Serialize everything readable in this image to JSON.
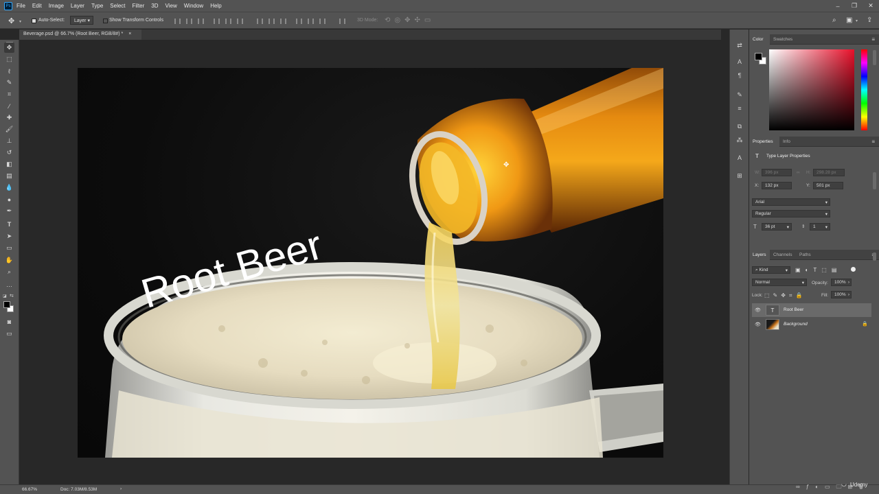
{
  "app": {
    "logo_text": "Ps",
    "menu": [
      "File",
      "Edit",
      "Image",
      "Layer",
      "Type",
      "Select",
      "Filter",
      "3D",
      "View",
      "Window",
      "Help"
    ]
  },
  "options_bar": {
    "auto_select_label": "Auto-Select:",
    "auto_select_value": "Layer",
    "show_transform_label": "Show Transform Controls",
    "mode_3d_label": "3D Mode:"
  },
  "document": {
    "tab_title": "Beverage.psd @ 66.7% (Root Beer, RGB/8#) *",
    "tab_close": "×",
    "canvas_text": "Root Beer"
  },
  "status": {
    "zoom": "66.67%",
    "doc_size": "Doc: 7.03M/8.53M",
    "arrow": "›"
  },
  "color_panel": {
    "tabs": [
      "Color",
      "Swatches"
    ],
    "fg_color": "#000000",
    "bg_color": "#ffffff",
    "hue_color": "#e8102a"
  },
  "properties_panel": {
    "tabs": [
      "Properties",
      "Info"
    ],
    "heading": "Type Layer Properties",
    "w_label": "W:",
    "w_value": "396 px",
    "h_label": "H:",
    "h_value": "298.28 px",
    "x_label": "X:",
    "x_value": "132 px",
    "y_label": "Y:",
    "y_value": "501 px",
    "font_family": "Arial",
    "font_style": "Regular",
    "font_size": "36 pt",
    "leading": "1"
  },
  "layers_panel": {
    "tabs": [
      "Layers",
      "Channels",
      "Paths"
    ],
    "filter_kind": "Kind",
    "blend_mode": "Normal",
    "opacity_label": "Opacity:",
    "opacity_value": "100%",
    "lock_label": "Lock:",
    "fill_label": "Fill:",
    "fill_value": "100%",
    "layers": [
      {
        "name": "Root Beer",
        "type": "text",
        "selected": true
      },
      {
        "name": "Background",
        "type": "image",
        "locked": true
      }
    ]
  },
  "watermark": {
    "text": "Udemy"
  }
}
